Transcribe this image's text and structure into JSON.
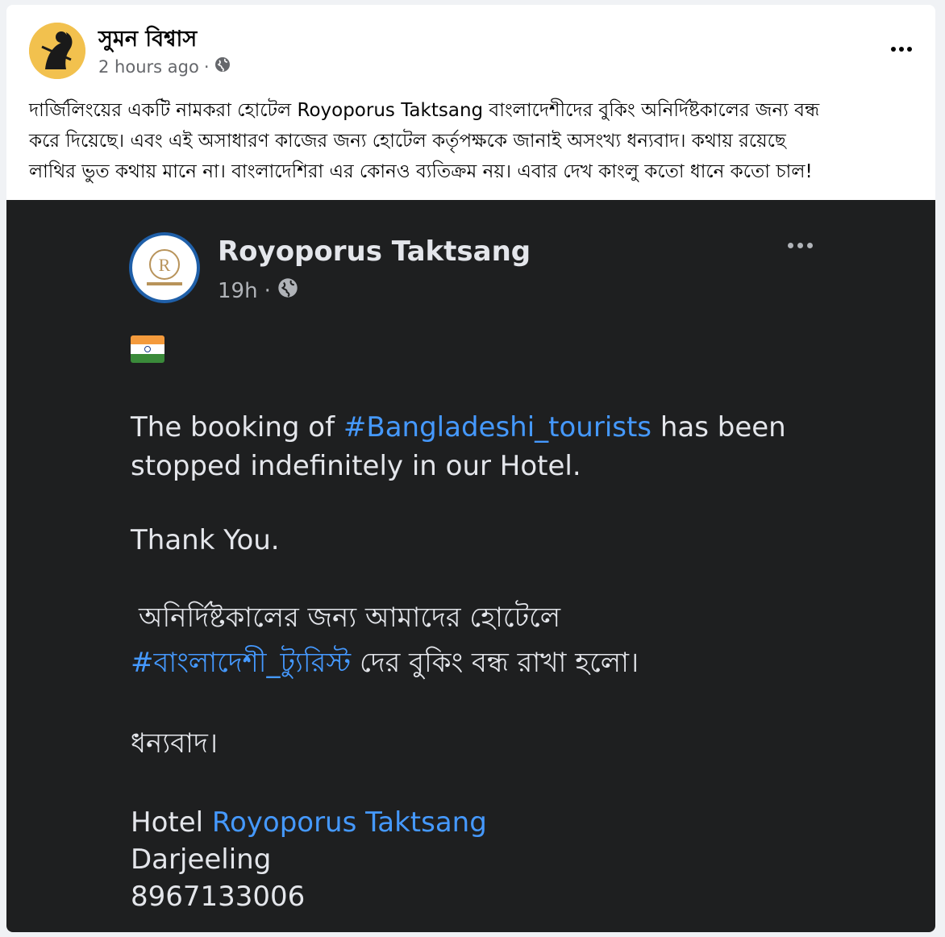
{
  "post": {
    "author": "সুমন বিশ্বাস",
    "time": "2 hours ago",
    "separator": "·",
    "privacy_icon": "globe-icon",
    "text_lines": [
      "দার্জিলিংয়ের একটি নামকরা হোটেল Royoporus Taktsang বাংলাদেশীদের বুকিং অনির্দিষ্টকালের জন্য বন্ধ",
      "করে দিয়েছে। এবং এই অসাধারণ কাজের জন্য হোটেল কর্তৃপক্ষকে জানাই অসংখ্য ধন্যবাদ। কথায় রয়েছে",
      "লাথির ভুত কথায় মানে না। বাংলাদেশিরা এর কোনও ব্যতিক্রম নয়। এবার দেখ কাংলু কতো ধানে কতো চাল!"
    ]
  },
  "shared": {
    "page_name": "Royoporus Taktsang",
    "time": "19h",
    "separator": "·",
    "flag": "india-flag-icon",
    "line1_pre": "The booking of ",
    "line1_tag": "#Bangladeshi_tourists",
    "line1_post": " has been",
    "line2": "stopped indefinitely in our Hotel.",
    "thanks": "Thank You.",
    "bn_line1": "অনির্দিষ্টকালের জন্য আমাদের হোটেলে",
    "bn_tag": "#বাংলাদেশী_ট্যুরিস্ট",
    "bn_line2_post": " দের বুকিং বন্ধ রাখা হলো।",
    "bn_thanks": "ধন্যবাদ।",
    "sig_hotel": "Hotel ",
    "sig_name": "Royoporus Taktsang",
    "sig_city": "Darjeeling",
    "sig_phone": "8967133006"
  },
  "colors": {
    "link": "#4599ff",
    "dark_bg": "#1e1f20",
    "meta": "#65676b"
  }
}
